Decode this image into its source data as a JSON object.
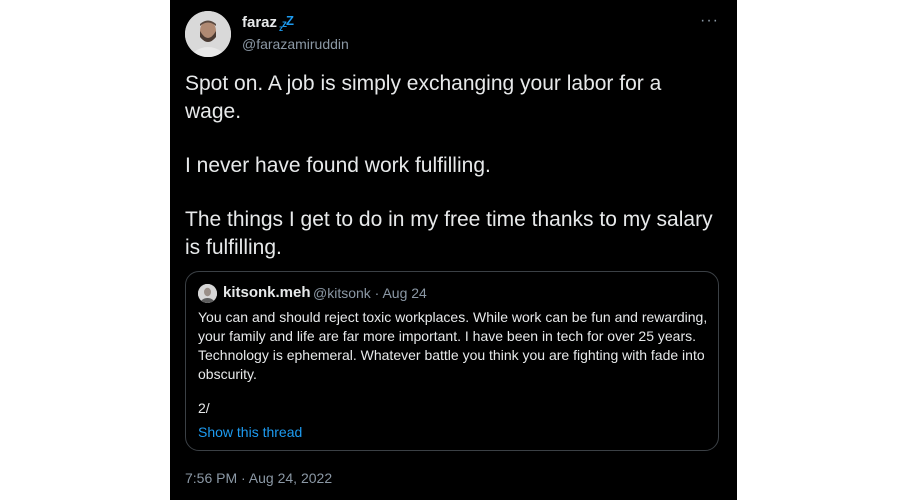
{
  "author": {
    "display_name": "faraz",
    "status_icon": "zzz-icon",
    "handle": "@farazamiruddin"
  },
  "menu": {
    "icon": "more-icon",
    "glyph": "···"
  },
  "tweet": {
    "paragraphs": [
      "Spot on. A job is simply exchanging your labor for a wage.",
      "I never have found work fulfilling.",
      "The things I get to do in my free time thanks to my salary is fulfilling."
    ],
    "timestamp": "7:56 PM · Aug 24, 2022"
  },
  "quoted_tweet": {
    "display_name": "kitsonk.meh",
    "handle_date": "@kitsonk · Aug 24",
    "text": "You can and should reject toxic workplaces. While work can be fun and rewarding, your family and life are far more important. I have been in tech for over 25 years. Technology is ephemeral. Whatever battle you think you are fighting with fade into obscurity.",
    "thread_number": "2/",
    "show_thread_label": "Show this thread"
  },
  "colors": {
    "background": "#000000",
    "text": "#e7e9ea",
    "secondary": "#8b98a5",
    "accent": "#1d9bf0",
    "border": "#3b4045"
  }
}
